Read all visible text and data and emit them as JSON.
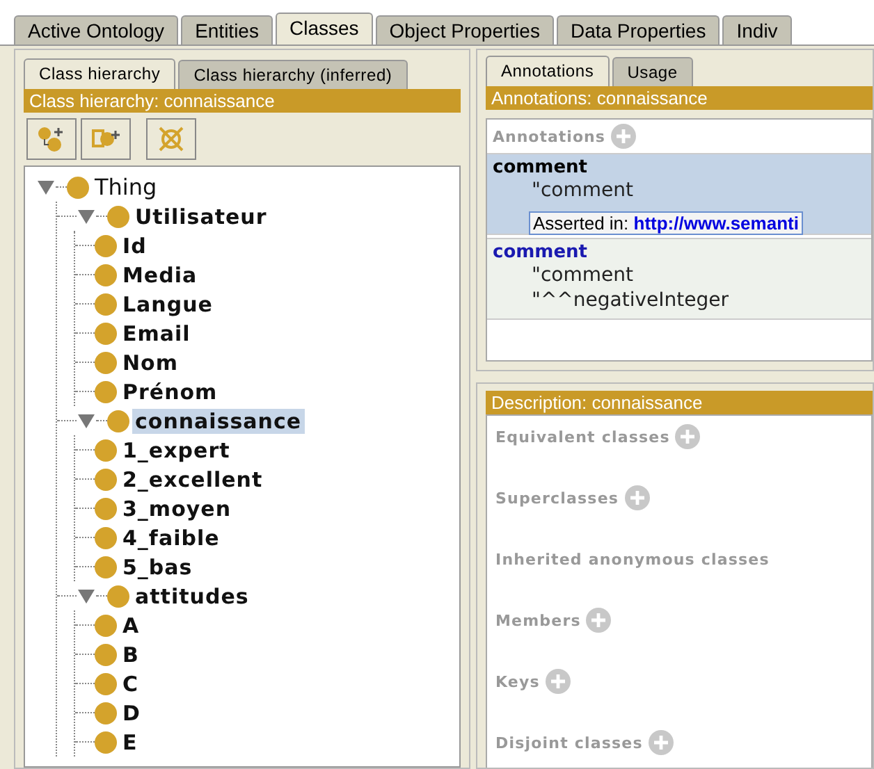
{
  "tabs": [
    {
      "label": "Active Ontology",
      "selected": false
    },
    {
      "label": "Entities",
      "selected": false
    },
    {
      "label": "Classes",
      "selected": true
    },
    {
      "label": "Object Properties",
      "selected": false
    },
    {
      "label": "Data Properties",
      "selected": false
    },
    {
      "label": "Indiv",
      "selected": false
    }
  ],
  "hierarchy": {
    "tabs": [
      {
        "label": "Class hierarchy",
        "selected": true
      },
      {
        "label": "Class hierarchy (inferred)",
        "selected": false
      }
    ],
    "title": "Class hierarchy: connaissance",
    "tree": [
      {
        "label": "Thing",
        "defined": false,
        "selected": false,
        "expanded": true,
        "children": [
          {
            "label": "Utilisateur",
            "defined": true,
            "selected": false,
            "expanded": true,
            "children": [
              {
                "label": "Id",
                "defined": true,
                "selected": false
              },
              {
                "label": "Media",
                "defined": true,
                "selected": false
              },
              {
                "label": "Langue",
                "defined": true,
                "selected": false
              },
              {
                "label": "Email",
                "defined": true,
                "selected": false
              },
              {
                "label": "Nom",
                "defined": true,
                "selected": false
              },
              {
                "label": "Prénom",
                "defined": true,
                "selected": false
              }
            ]
          },
          {
            "label": "connaissance",
            "defined": true,
            "selected": true,
            "expanded": true,
            "children": [
              {
                "label": "1_expert",
                "defined": true,
                "selected": false
              },
              {
                "label": "2_excellent",
                "defined": true,
                "selected": false
              },
              {
                "label": "3_moyen",
                "defined": true,
                "selected": false
              },
              {
                "label": "4_faible",
                "defined": true,
                "selected": false
              },
              {
                "label": "5_bas",
                "defined": true,
                "selected": false
              }
            ]
          },
          {
            "label": "attitudes",
            "defined": true,
            "selected": false,
            "expanded": true,
            "children": [
              {
                "label": "A",
                "defined": true,
                "selected": false
              },
              {
                "label": "B",
                "defined": true,
                "selected": false
              },
              {
                "label": "C",
                "defined": true,
                "selected": false
              },
              {
                "label": "D",
                "defined": true,
                "selected": false
              },
              {
                "label": "E",
                "defined": true,
                "selected": false
              }
            ]
          }
        ]
      }
    ]
  },
  "annotations": {
    "tabs": [
      {
        "label": "Annotations",
        "selected": true
      },
      {
        "label": "Usage",
        "selected": false
      }
    ],
    "title": "Annotations: connaissance",
    "section": "Annotations",
    "items": [
      {
        "property": "comment",
        "selected": true,
        "values": [
          "\"comment"
        ]
      },
      {
        "property": "comment",
        "selected": false,
        "values": [
          "\"comment",
          "\"^^negativeInteger"
        ]
      }
    ],
    "tooltip": {
      "label": "Asserted in:",
      "link": "http://www.semanti"
    }
  },
  "description": {
    "title": "Description: connaissance",
    "sections": [
      {
        "label": "Equivalent classes",
        "add": true
      },
      {
        "label": "Superclasses",
        "add": true
      },
      {
        "label": "Inherited anonymous classes",
        "add": false
      },
      {
        "label": "Members",
        "add": true
      },
      {
        "label": "Keys",
        "add": true
      },
      {
        "label": "Disjoint classes",
        "add": true
      }
    ]
  }
}
